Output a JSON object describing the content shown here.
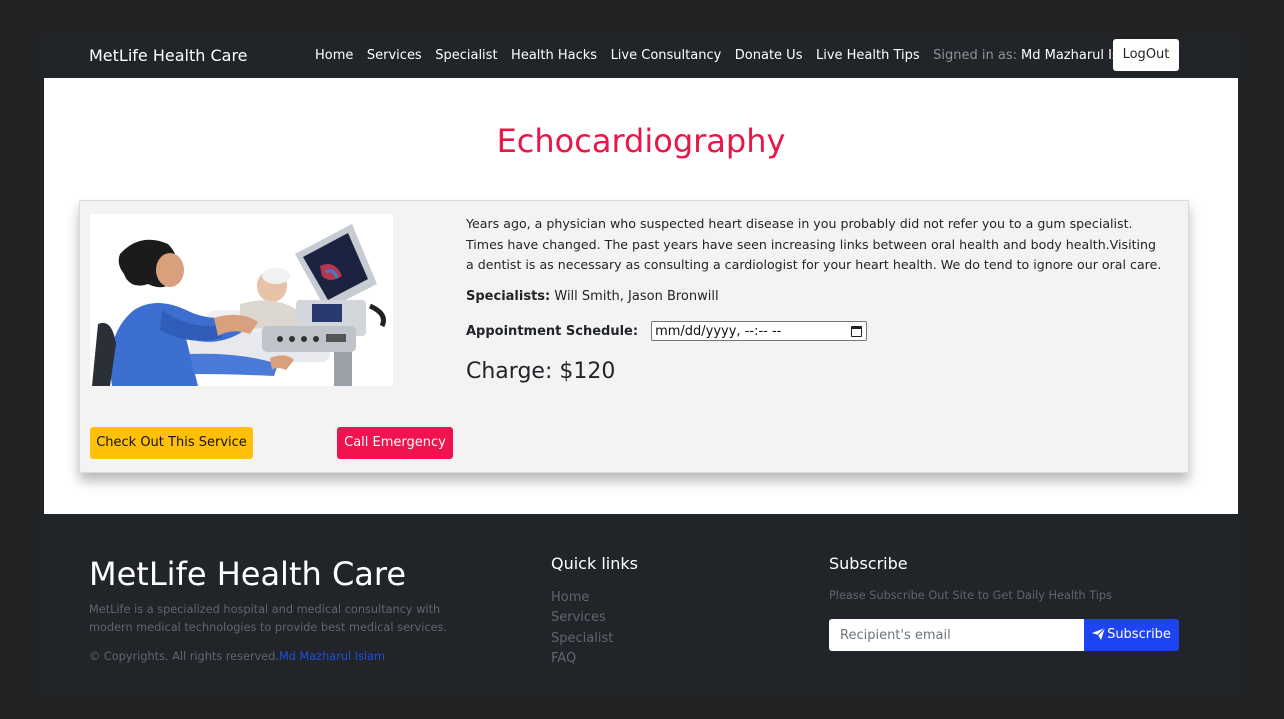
{
  "navbar": {
    "brand": "MetLife Health Care",
    "links": [
      "Home",
      "Services",
      "Specialist",
      "Health Hacks",
      "Live Consultancy",
      "Donate Us",
      "Live Health Tips"
    ],
    "signed_in_label": "Signed in as:",
    "user_name": "Md Mazharul Islam",
    "logout_label": "LogOut"
  },
  "service": {
    "title": "Echocardiography",
    "description": "Years ago, a physician who suspected heart disease in you probably did not refer you to a gum specialist. Times have changed. The past years have seen increasing links between oral health and body health.Visiting a dentist is as necessary as consulting a cardiologist for your heart health. We do tend to ignore our oral care.",
    "specialists_label": "Specialists:",
    "specialists": "Will Smith, Jason Bronwill",
    "appointment_label": "Appointment Schedule:",
    "appointment_placeholder": "mm/dd/yyyy, --:-- --",
    "charge_label": "Charge:",
    "charge_value": "$120",
    "checkout_label": "Check Out This Service",
    "emergency_label": "Call Emergency"
  },
  "footer": {
    "brand": "MetLife Health Care",
    "about": "MetLife is a specialized hospital and medical consultancy with modern medical technologies to provide best medical services.",
    "copyright": "© Copyrights. All rights reserved.",
    "author": "Md Mazharul Islam",
    "quick_links_title": "Quick links",
    "quick_links": [
      "Home",
      "Services",
      "Specialist",
      "FAQ"
    ],
    "subscribe_title": "Subscribe",
    "subscribe_text": "Please Subscribe Out Site to Get Daily Health Tips",
    "email_placeholder": "Recipient's email",
    "subscribe_button": "Subscribe"
  },
  "colors": {
    "title": "#e8174a",
    "navbar": "#212529",
    "checkout": "#ffc107",
    "emergency": "#f0134d",
    "subscribe": "#1d44f0"
  },
  "icons": [
    "calendar-icon",
    "paper-plane-icon"
  ]
}
